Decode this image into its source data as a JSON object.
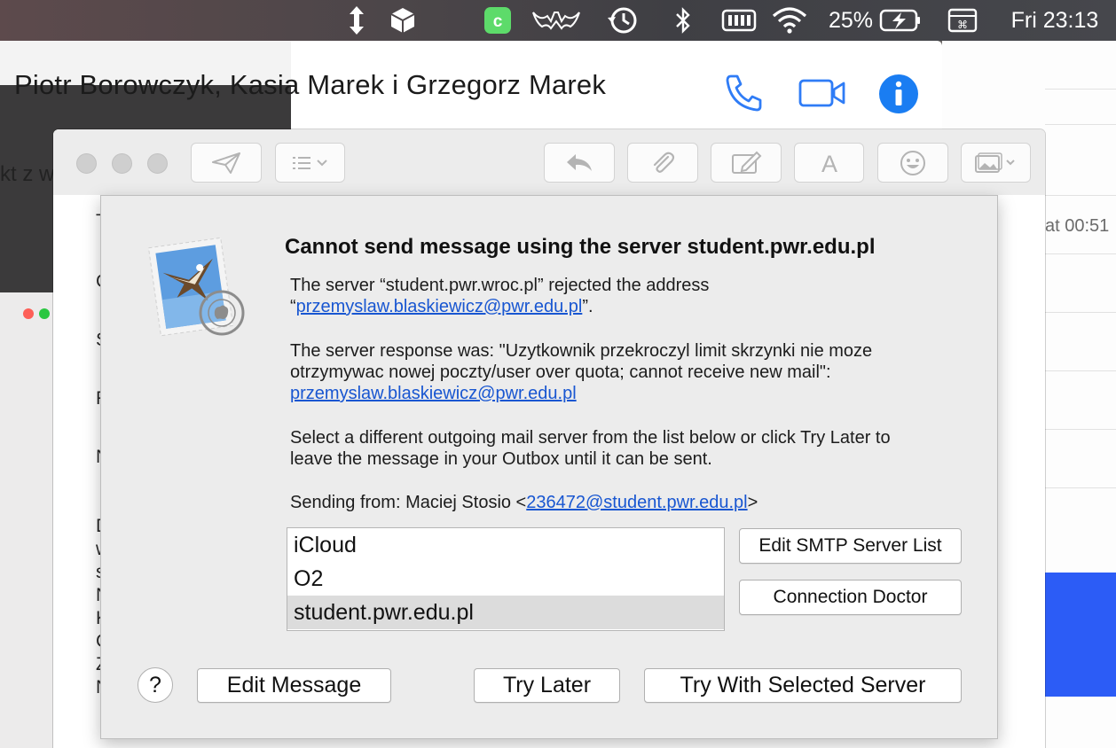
{
  "menubar": {
    "battery_percent": "25%",
    "clock": "Fri 23:13",
    "icons": [
      "arrows-icon",
      "cube-icon",
      "app-icon",
      "bat-icon",
      "time-machine-icon",
      "bluetooth-icon",
      "memory-icon",
      "wifi-icon",
      "battery-icon",
      "keyboard-icon"
    ]
  },
  "background": {
    "left_fragment": "kt z w",
    "chat_title": "Piotr Borowczyk, Kasia Marek i Grzegorz Marek",
    "right_timestamp": "at 00:51",
    "compose_letters": [
      "T",
      "C",
      "S",
      "F",
      "N",
      "D",
      "w",
      "s",
      "N",
      "K",
      "C",
      "Z",
      "N"
    ]
  },
  "alert": {
    "title": "Cannot send message using the server student.pwr.edu.pl",
    "para1_a": "The server “student.pwr.wroc.pl” rejected the address",
    "para1_open": "“",
    "para1_link": "przemyslaw.blaskiewicz@pwr.edu.pl",
    "para1_close": "”.",
    "para2_a": "The server response was: \"Uzytkownik przekroczyl limit skrzynki nie moze",
    "para2_b": "otrzymywac nowej poczty/user over quota; cannot receive new mail\":",
    "para2_link": "przemyslaw.blaskiewicz@pwr.edu.pl",
    "para3_a": "Select a different outgoing mail server from the list below or click Try Later to",
    "para3_b": "leave the message in your Outbox until it can be sent.",
    "sending_prefix": "Sending from: Maciej Stosio <",
    "sending_link": "236472@student.pwr.edu.pl",
    "sending_suffix": ">",
    "servers": [
      "iCloud",
      "O2",
      "student.pwr.edu.pl"
    ],
    "selected_server": "student.pwr.edu.pl",
    "buttons": {
      "edit_smtp": "Edit SMTP Server List",
      "connection_doctor": "Connection Doctor",
      "help": "?",
      "edit_message": "Edit Message",
      "try_later": "Try Later",
      "try_selected": "Try With Selected Server"
    }
  },
  "colors": {
    "link": "#1856d1",
    "info_blue": "#1a7df2",
    "icon_blue": "#2f7cf6",
    "selected_row": "#dcdcdc"
  }
}
